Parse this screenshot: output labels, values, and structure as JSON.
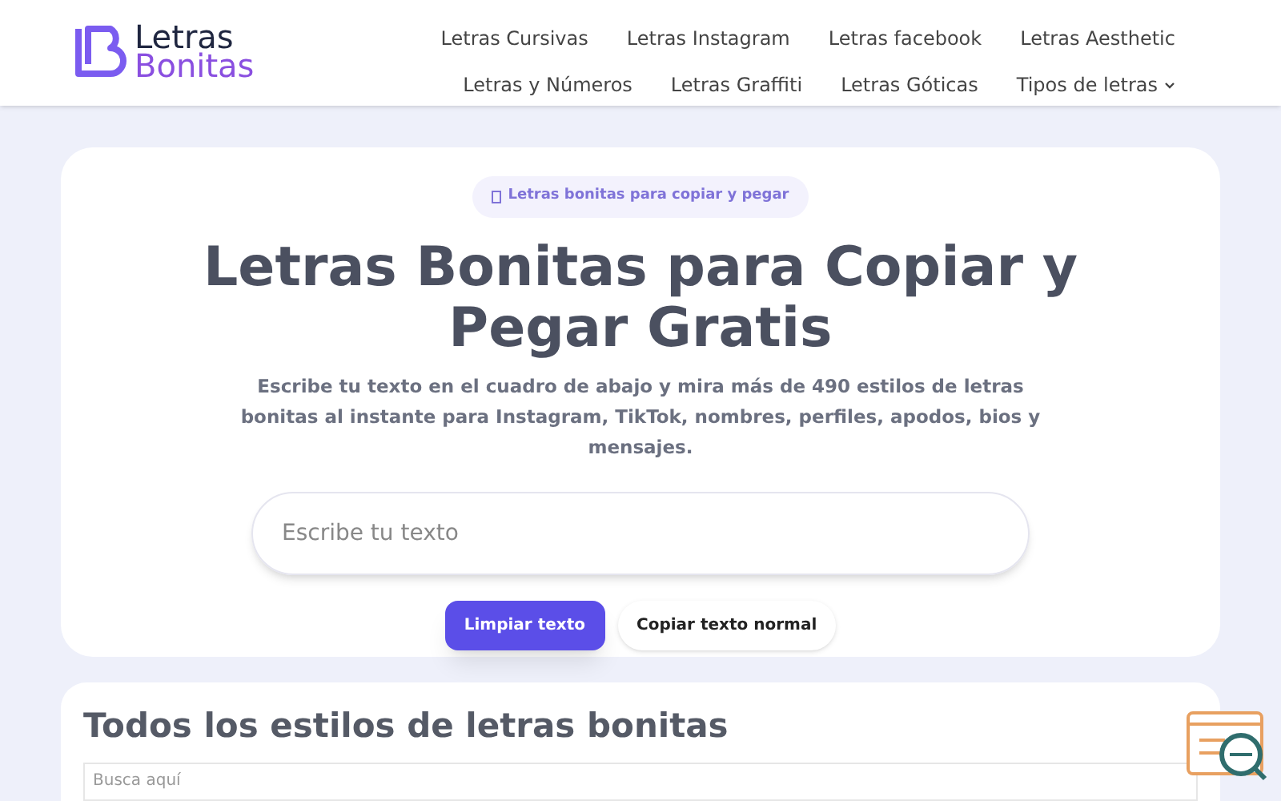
{
  "logo": {
    "line_1": "Letras",
    "line_2": "Bonitas"
  },
  "nav": [
    {
      "label": "Letras Cursivas",
      "kind": "link"
    },
    {
      "label": "Letras Instagram",
      "kind": "link"
    },
    {
      "label": "Letras facebook",
      "kind": "link"
    },
    {
      "label": "Letras Aesthetic",
      "kind": "link"
    },
    {
      "label": "Letras y Números",
      "kind": "link"
    },
    {
      "label": "Letras Graffiti",
      "kind": "link"
    },
    {
      "label": "Letras Góticas",
      "kind": "link"
    },
    {
      "label": "Tipos de letras",
      "kind": "dropdown"
    }
  ],
  "hero": {
    "badge": "Letras bonitas para copiar y pegar",
    "title": "Letras Bonitas para Copiar y Pegar Gratis",
    "subtitle": "Escribe tu texto en el cuadro de abajo y mira más de 490 estilos de letras bonitas al instante para Instagram, TikTok, nombres, perfiles, apodos, bios y mensajes.",
    "input": {
      "placeholder": "Escribe tu texto"
    },
    "buttons": [
      {
        "label": "Limpiar texto",
        "kind": "primary"
      },
      {
        "label": "Copiar texto normal",
        "kind": "secondary"
      }
    ]
  },
  "styles_section": {
    "title": "Todos los estilos de letras bonitas",
    "search": {
      "placeholder": "Busca aquí"
    }
  }
}
